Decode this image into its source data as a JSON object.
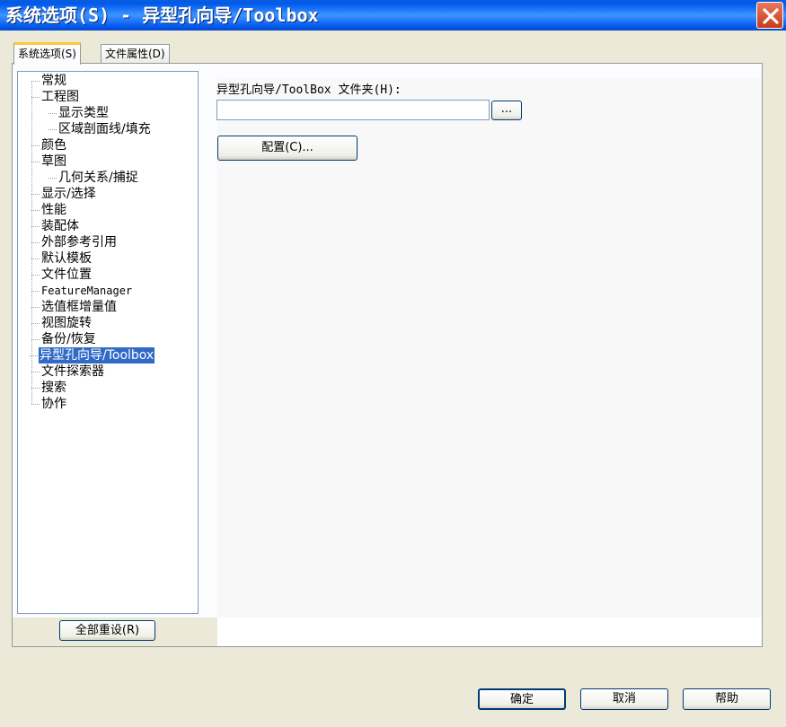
{
  "window": {
    "title": "系统选项(S) - 异型孔向导/Toolbox"
  },
  "tabs": [
    {
      "label": "系统选项(S)"
    },
    {
      "label": "文件属性(D)"
    }
  ],
  "tree": {
    "items": [
      {
        "label": "常规"
      },
      {
        "label": "工程图"
      },
      {
        "label": "显示类型"
      },
      {
        "label": "区域剖面线/填充"
      },
      {
        "label": "颜色"
      },
      {
        "label": "草图"
      },
      {
        "label": "几何关系/捕捉"
      },
      {
        "label": "显示/选择"
      },
      {
        "label": "性能"
      },
      {
        "label": "装配体"
      },
      {
        "label": "外部参考引用"
      },
      {
        "label": "默认模板"
      },
      {
        "label": "文件位置"
      },
      {
        "label": "FeatureManager"
      },
      {
        "label": "选值框增量值"
      },
      {
        "label": "视图旋转"
      },
      {
        "label": "备份/恢复"
      },
      {
        "label": "异型孔向导/Toolbox"
      },
      {
        "label": "文件探索器"
      },
      {
        "label": "搜索"
      },
      {
        "label": "协作"
      }
    ],
    "selected": "异型孔向导/Toolbox"
  },
  "content": {
    "folder_label": "异型孔向导/ToolBox 文件夹(H):",
    "folder_value": "",
    "browse_label": "...",
    "configure_label": "配置(C)..."
  },
  "reset_all_label": "全部重设(R)",
  "footer": {
    "ok_label": "确定",
    "cancel_label": "取消",
    "help_label": "帮助"
  },
  "colors": {
    "titlebar": "#0058EE",
    "selection": "#316AC5",
    "dialog_bg": "#ECE9D8"
  }
}
